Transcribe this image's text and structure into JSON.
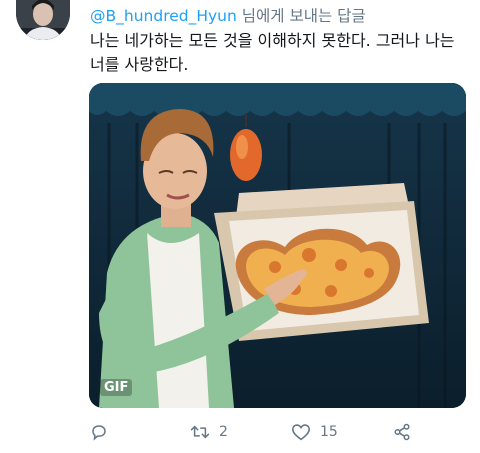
{
  "tweet": {
    "handle": "@B_hundred_Hyun",
    "reply_suffix": " 님에게 보내는 답글",
    "text": "나는 네가하는 모든 것을 이해하지 못한다. 그러나 나는 너를 사랑한다."
  },
  "media": {
    "badge": "GIF"
  },
  "actions": {
    "reply_icon": "comment-icon",
    "retweet_icon": "retweet-icon",
    "retweet_count": "2",
    "like_icon": "heart-icon",
    "like_count": "15",
    "share_icon": "share-icon"
  },
  "colors": {
    "link": "#1da1f2",
    "muted": "#657786",
    "text": "#14171a"
  }
}
